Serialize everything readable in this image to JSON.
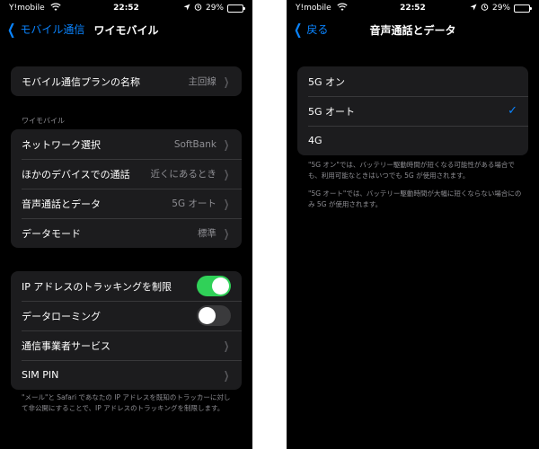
{
  "left": {
    "status": {
      "carrier": "Y!mobile",
      "time": "22:52",
      "battery": "29%",
      "battery_level": 0.29
    },
    "nav": {
      "back": "モバイル通信",
      "title": "ワイモバイル"
    },
    "plan_row": {
      "label": "モバイル通信プランの名称",
      "value": "主回線"
    },
    "section_header": "ワイモバイル",
    "rows": [
      {
        "label": "ネットワーク選択",
        "value": "SoftBank"
      },
      {
        "label": "ほかのデバイスでの通話",
        "value": "近くにあるとき"
      },
      {
        "label": "音声通話とデータ",
        "value": "5G オート"
      },
      {
        "label": "データモード",
        "value": "標準"
      }
    ],
    "rows2": {
      "ip_tracking": {
        "label": "IP アドレスのトラッキングを制限",
        "on": true
      },
      "roaming": {
        "label": "データローミング",
        "on": false
      },
      "carrier_services": {
        "label": "通信事業者サービス"
      },
      "sim_pin": {
        "label": "SIM PIN"
      }
    },
    "footer": "\"メール\"と Safari であなたの IP アドレスを既知のトラッカーに対して非公開にすることで、IP アドレスのトラッキングを制限します。"
  },
  "right": {
    "status": {
      "carrier": "Y!mobile",
      "time": "22:52",
      "battery": "29%",
      "battery_level": 0.29
    },
    "nav": {
      "back": "戻る",
      "title": "音声通話とデータ"
    },
    "options": [
      {
        "label": "5G オン",
        "selected": false
      },
      {
        "label": "5G オート",
        "selected": true
      },
      {
        "label": "4G",
        "selected": false
      }
    ],
    "footer1": "\"5G オン\"では、バッテリー駆動時間が短くなる可能性がある場合でも、利用可能なときはいつでも 5G が使用されます。",
    "footer2": "\"5G オート\"では、バッテリー駆動時間が大幅に短くならない場合にのみ 5G が使用されます。"
  },
  "icons": {
    "wifi": "wifi-icon",
    "location": "location-arrow-icon",
    "alarm": "alarm-icon",
    "battery": "battery-icon",
    "back": "chevron-left-icon",
    "disclosure": "chevron-right-icon",
    "check": "checkmark-icon"
  },
  "colors": {
    "accent": "#0a84ff",
    "toggle_on": "#30d158",
    "cell_bg": "#1c1c1e",
    "background": "#000000"
  }
}
